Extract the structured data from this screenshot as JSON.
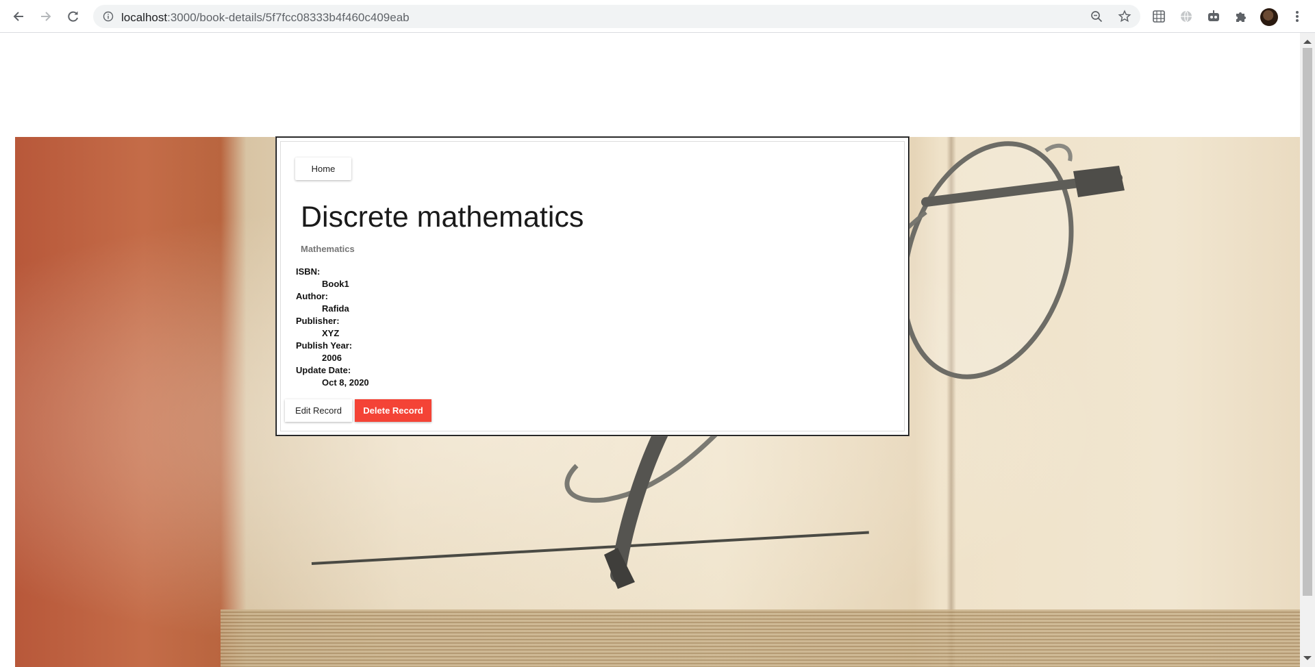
{
  "browser": {
    "url_host": "localhost",
    "url_rest": ":3000/book-details/5f7fcc08333b4f460c409eab"
  },
  "nav": {
    "home_label": "Home"
  },
  "book": {
    "title": "Discrete mathematics",
    "category": "Mathematics",
    "fields": [
      {
        "label": "ISBN:",
        "value": "Book1"
      },
      {
        "label": "Author:",
        "value": "Rafida"
      },
      {
        "label": "Publisher:",
        "value": "XYZ"
      },
      {
        "label": "Publish Year:",
        "value": "2006"
      },
      {
        "label": "Update Date:",
        "value": "Oct 8, 2020"
      }
    ]
  },
  "actions": {
    "edit_label": "Edit Record",
    "delete_label": "Delete Record"
  },
  "colors": {
    "delete_button": "#f44336",
    "omnibox_bg": "#f1f3f4"
  },
  "icons": {
    "back": "back-arrow-icon",
    "forward": "forward-arrow-icon",
    "reload": "reload-icon",
    "site_info": "info-icon",
    "zoom": "zoom-icon",
    "bookmark": "star-icon",
    "extensions": [
      "translate-extension-icon",
      "globe-extension-icon",
      "robot-extension-icon",
      "puzzle-icon"
    ],
    "menu": "kebab-menu-icon"
  }
}
